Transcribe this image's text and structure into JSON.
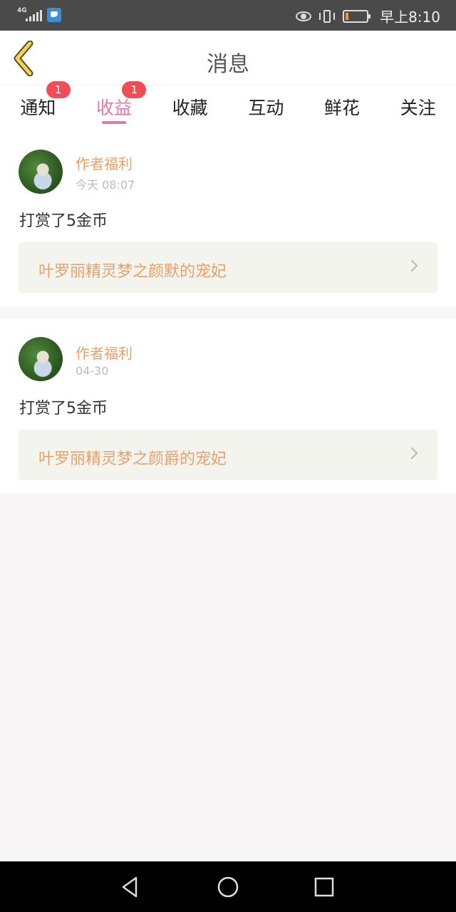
{
  "status_bar": {
    "network_label": "4G",
    "time": "早上8:10",
    "battery_level": 0.15,
    "battery_color": "#f59a23"
  },
  "header": {
    "title": "消息"
  },
  "tabs": [
    {
      "label": "通知",
      "badge": "1",
      "active": false
    },
    {
      "label": "收益",
      "badge": "1",
      "active": true
    },
    {
      "label": "收藏",
      "badge": "",
      "active": false
    },
    {
      "label": "互动",
      "badge": "",
      "active": false
    },
    {
      "label": "鲜花",
      "badge": "",
      "active": false
    },
    {
      "label": "关注",
      "badge": "",
      "active": false
    }
  ],
  "messages": [
    {
      "sender": "作者福利",
      "time": "今天 08:07",
      "content": "打赏了5金币",
      "book": "叶罗丽精灵梦之颜默的宠妃"
    },
    {
      "sender": "作者福利",
      "time": "04-30",
      "content": "打赏了5金币",
      "book": "叶罗丽精灵梦之颜爵的宠妃"
    }
  ],
  "colors": {
    "accent": "#e07aa8",
    "badge": "#f04d57",
    "orange_text": "#e8a06a"
  }
}
